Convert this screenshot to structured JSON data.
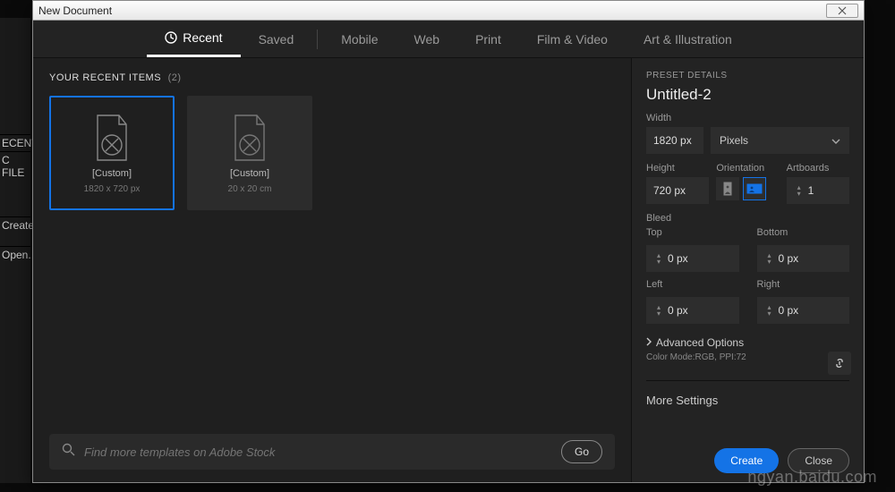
{
  "background_sidebar": {
    "recent": "ECENT",
    "cfiles": "C FILE",
    "create": "Create",
    "open": "Open."
  },
  "titlebar": {
    "title": "New Document"
  },
  "tabs": {
    "recent": "Recent",
    "saved": "Saved",
    "mobile": "Mobile",
    "web": "Web",
    "print": "Print",
    "film": "Film & Video",
    "art": "Art & Illustration"
  },
  "recent": {
    "heading": "YOUR RECENT ITEMS",
    "count": "(2)",
    "cards": [
      {
        "title": "[Custom]",
        "subtitle": "1820 x 720 px"
      },
      {
        "title": "[Custom]",
        "subtitle": "20 x 20 cm"
      }
    ]
  },
  "search": {
    "placeholder": "Find more templates on Adobe Stock",
    "go": "Go"
  },
  "preset": {
    "section": "PRESET DETAILS",
    "name": "Untitled-2",
    "width_label": "Width",
    "width_value": "1820 px",
    "units": "Pixels",
    "height_label": "Height",
    "height_value": "720 px",
    "orientation_label": "Orientation",
    "artboards_label": "Artboards",
    "artboards_value": "1",
    "bleed_label": "Bleed",
    "top_label": "Top",
    "bottom_label": "Bottom",
    "left_label": "Left",
    "right_label": "Right",
    "top": "0 px",
    "bottom": "0 px",
    "left": "0 px",
    "right": "0 px",
    "advanced": "Advanced Options",
    "colormode": "Color Mode:RGB, PPI:72",
    "more": "More Settings"
  },
  "footer": {
    "create": "Create",
    "close": "Close"
  },
  "watermark": "ngyan.baidu.com"
}
